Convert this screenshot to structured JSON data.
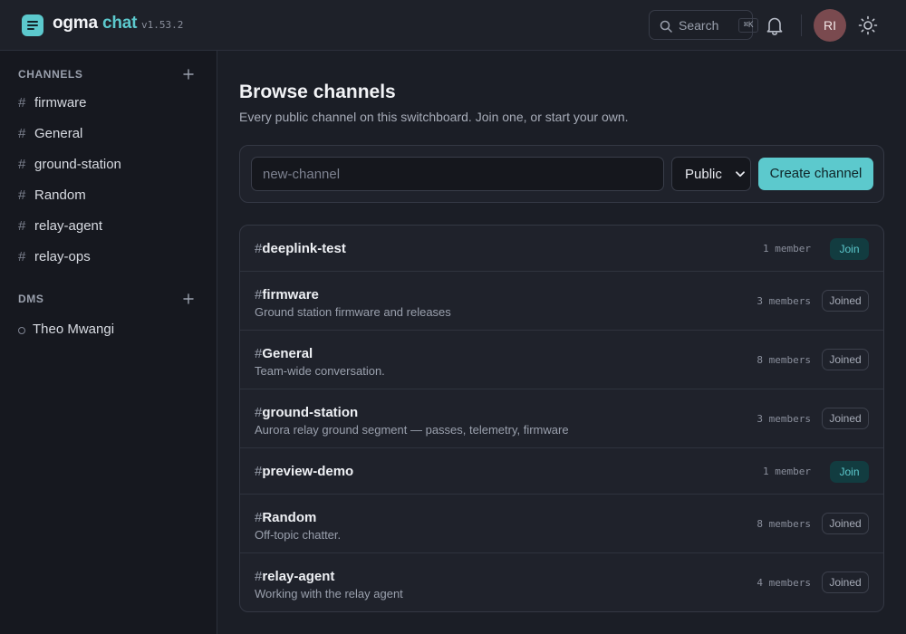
{
  "header": {
    "brand_part1": "ogma",
    "brand_part2": "chat",
    "version": "v1.53.2",
    "search_label": "Search",
    "search_shortcut": "⌘K",
    "avatar_initials": "RI"
  },
  "sidebar": {
    "channels_heading": "CHANNELS",
    "channels": [
      {
        "name": "firmware"
      },
      {
        "name": "General"
      },
      {
        "name": "ground-station"
      },
      {
        "name": "Random"
      },
      {
        "name": "relay-agent"
      },
      {
        "name": "relay-ops"
      }
    ],
    "dms_heading": "DMS",
    "dms": [
      {
        "name": "Theo Mwangi"
      }
    ]
  },
  "main": {
    "title": "Browse channels",
    "subtitle": "Every public channel on this switchboard. Join one, or start your own.",
    "create": {
      "placeholder": "new-channel",
      "visibility": "Public",
      "button": "Create channel"
    },
    "channels": [
      {
        "name": "deeplink-test",
        "description": "",
        "members": "1 member",
        "status": "Join"
      },
      {
        "name": "firmware",
        "description": "Ground station firmware and releases",
        "members": "3 members",
        "status": "Joined"
      },
      {
        "name": "General",
        "description": "Team-wide conversation.",
        "members": "8 members",
        "status": "Joined"
      },
      {
        "name": "ground-station",
        "description": "Aurora relay ground segment — passes, telemetry, firmware",
        "members": "3 members",
        "status": "Joined"
      },
      {
        "name": "preview-demo",
        "description": "",
        "members": "1 member",
        "status": "Join"
      },
      {
        "name": "Random",
        "description": "Off-topic chatter.",
        "members": "8 members",
        "status": "Joined"
      },
      {
        "name": "relay-agent",
        "description": "Working with the relay agent",
        "members": "4 members",
        "status": "Joined"
      }
    ]
  },
  "colors": {
    "accent": "#5cc9cd",
    "background": "#1b1e26",
    "sidebar": "#16181f",
    "avatar": "#7a4a4f"
  }
}
